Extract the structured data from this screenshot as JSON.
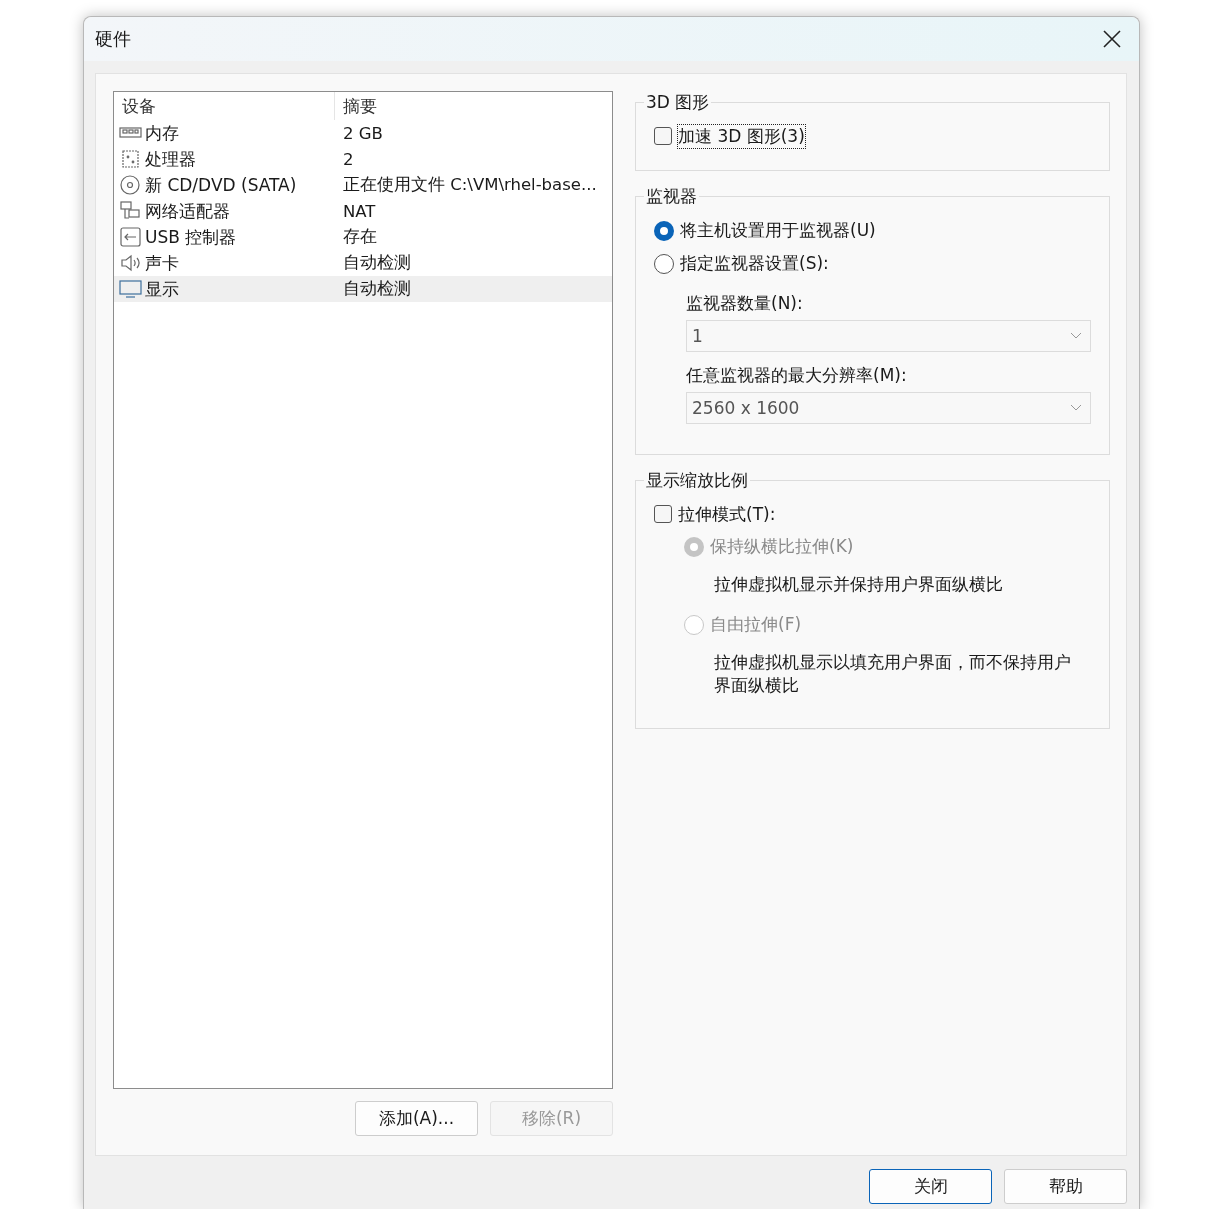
{
  "window": {
    "title": "硬件"
  },
  "devices": {
    "columns": [
      "设备",
      "摘要"
    ],
    "rows": [
      {
        "kind": "memory",
        "device": "内存",
        "summary": "2 GB",
        "selected": false
      },
      {
        "kind": "processor",
        "device": "处理器",
        "summary": "2",
        "selected": false
      },
      {
        "kind": "disc",
        "device": "新 CD/DVD (SATA)",
        "summary": "正在使用文件 C:\\VM\\rhel-base...",
        "selected": false
      },
      {
        "kind": "network",
        "device": "网络适配器",
        "summary": "NAT",
        "selected": false
      },
      {
        "kind": "usb",
        "device": "USB 控制器",
        "summary": "存在",
        "selected": false
      },
      {
        "kind": "sound",
        "device": "声卡",
        "summary": "自动检测",
        "selected": false
      },
      {
        "kind": "display",
        "device": "显示",
        "summary": "自动检测",
        "selected": true
      }
    ],
    "buttons": [
      {
        "label": "添加(A)...",
        "disabled": false
      },
      {
        "label": "移除(R)",
        "disabled": true
      }
    ]
  },
  "graphics_3d": {
    "title": "3D 图形",
    "checkbox": {
      "label": "加速 3D 图形(3)",
      "checked": false,
      "focused": true
    }
  },
  "monitors": {
    "title": "监视器",
    "options": [
      {
        "label": "将主机设置用于监视器(U)",
        "selected": true
      },
      {
        "label": "指定监视器设置(S):",
        "selected": false
      }
    ],
    "count": {
      "label": "监视器数量(N):",
      "value": "1",
      "disabled": true
    },
    "max_resolution": {
      "label": "任意监视器的最大分辨率(M):",
      "value": "2560 x 1600",
      "disabled": true
    }
  },
  "scaling": {
    "title": "显示缩放比例",
    "checkbox": {
      "label": "拉伸模式(T):",
      "checked": false
    },
    "options": [
      {
        "label": "保持纵横比拉伸(K)",
        "selected": true,
        "disabled": true,
        "description": "拉伸虚拟机显示并保持用户界面纵横比"
      },
      {
        "label": "自由拉伸(F)",
        "selected": false,
        "disabled": true,
        "description": "拉伸虚拟机显示以填充用户界面，而不保持用户界面纵横比"
      }
    ]
  },
  "footer_buttons": [
    {
      "label": "关闭",
      "default": true
    },
    {
      "label": "帮助",
      "default": false
    }
  ]
}
